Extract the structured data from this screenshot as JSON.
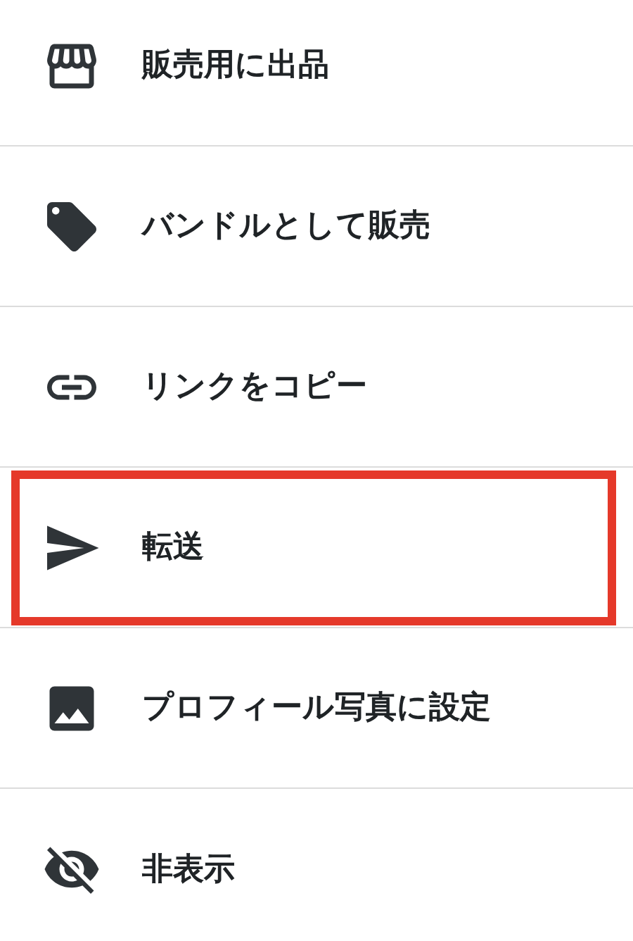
{
  "menu": {
    "items": [
      {
        "label": "販売用に出品",
        "highlighted": false
      },
      {
        "label": "バンドルとして販売",
        "highlighted": false
      },
      {
        "label": "リンクをコピー",
        "highlighted": false
      },
      {
        "label": "転送",
        "highlighted": true
      },
      {
        "label": "プロフィール写真に設定",
        "highlighted": false
      },
      {
        "label": "非表示",
        "highlighted": false
      }
    ]
  }
}
